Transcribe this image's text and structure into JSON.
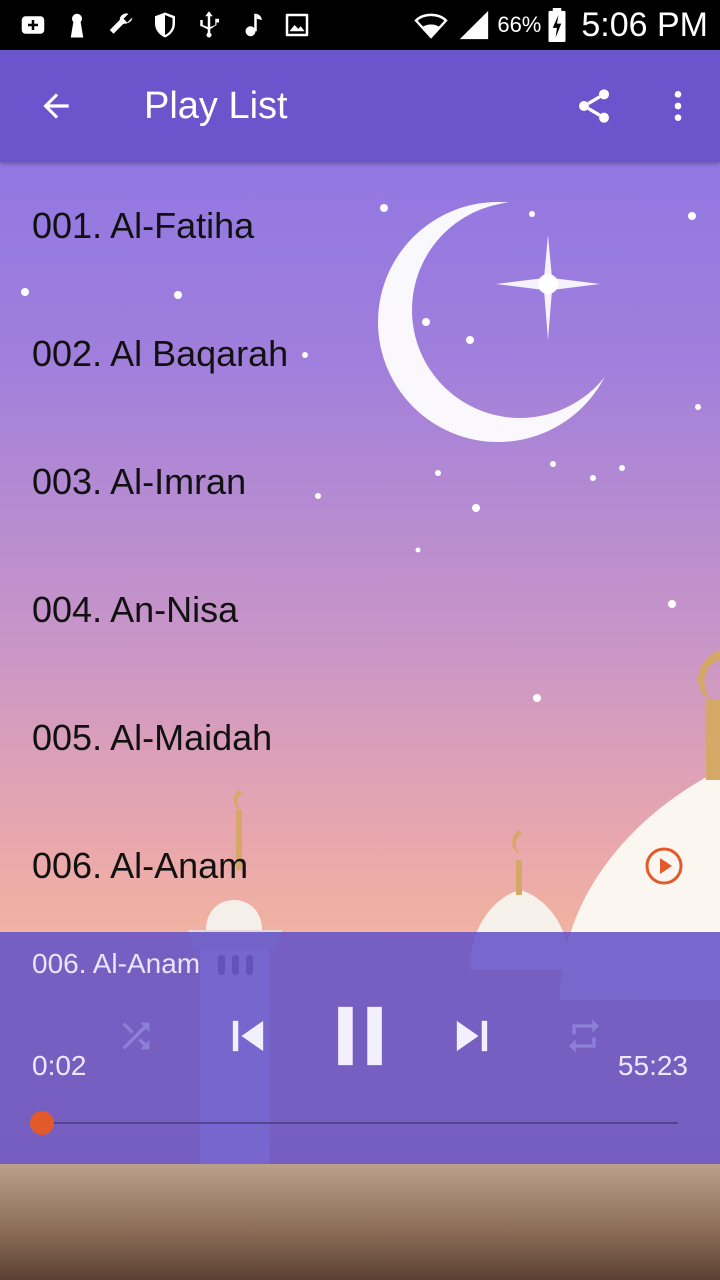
{
  "statusbar": {
    "battery": "66%",
    "time": "5:06 PM",
    "icons": [
      "add-box-icon",
      "keyhole-icon",
      "wrench-icon",
      "shield-icon",
      "usb-icon",
      "music-note-icon",
      "image-icon",
      "wifi-icon",
      "signal-icon",
      "battery-icon"
    ]
  },
  "appbar": {
    "title": "Play List",
    "back_icon": "arrow-back-icon",
    "share_icon": "share-icon",
    "menu_icon": "more-vert-icon"
  },
  "playlist": {
    "items": [
      {
        "label": "001. Al-Fatiha"
      },
      {
        "label": "002. Al Baqarah"
      },
      {
        "label": "003. Al-Imran"
      },
      {
        "label": "004. An-Nisa"
      },
      {
        "label": "005. Al-Maidah"
      },
      {
        "label": "006. Al-Anam"
      }
    ],
    "playing_index": 5
  },
  "player": {
    "now_playing": "006. Al-Anam",
    "elapsed": "0:02",
    "duration": "55:23",
    "progress_fraction": 0.0006,
    "accent_color": "#e35a2a",
    "controls": [
      "shuffle-icon",
      "skip-previous-icon",
      "pause-icon",
      "skip-next-icon",
      "repeat-icon"
    ]
  }
}
